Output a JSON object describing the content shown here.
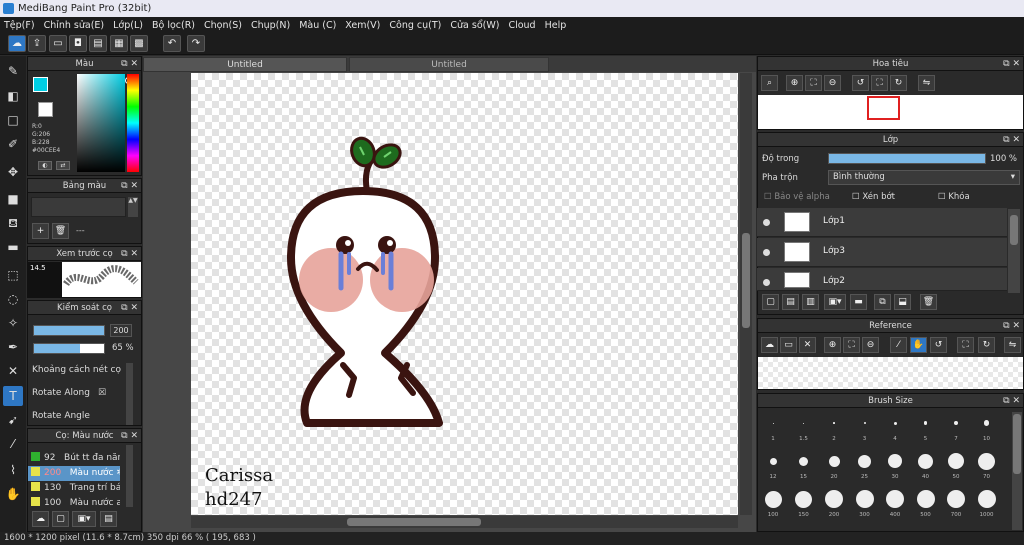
{
  "window": {
    "title": "MediBang Paint Pro (32bit)"
  },
  "menu": [
    "Tệp(F)",
    "Chỉnh sửa(E)",
    "Lớp(L)",
    "Bộ lọc(R)",
    "Chọn(S)",
    "Chụp(N)",
    "Màu (C)",
    "Xem(V)",
    "Công cụ(T)",
    "Cửa sổ(W)",
    "Cloud",
    "Help"
  ],
  "tabs": [
    "Untitled",
    "Untitled"
  ],
  "color": {
    "title": "Màu",
    "r": "R:0",
    "g": "G:206",
    "b": "B:228",
    "hex": "#00CEE4",
    "fg": "#00cee4"
  },
  "palette": {
    "title": "Bảng màu",
    "dash": "---"
  },
  "preview": {
    "title": "Xem trước cọ",
    "size": "14.5"
  },
  "brushctl": {
    "title": "Kiểm soát cọ",
    "size": "200",
    "opacity": "65 %",
    "opts": [
      "Khoảng cách nét cọ",
      "Rotate Along",
      "Rotate Angle"
    ]
  },
  "brushes": {
    "title": "Cọ: Màu nước",
    "items": [
      {
        "size": "92",
        "name": "Bút tt đa năn",
        "color": "#2fb02f"
      },
      {
        "size": "200",
        "name": "Màu nước",
        "color": "#e6e34a",
        "selected": true
      },
      {
        "size": "130",
        "name": "Trang trí bánh",
        "color": "#e6e34a"
      },
      {
        "size": "100",
        "name": "Màu nước arti",
        "color": "#e6e34a"
      }
    ]
  },
  "artwork": {
    "signature1": "Carissa",
    "signature2": "hd247"
  },
  "navigator": {
    "title": "Hoa tiêu"
  },
  "layers": {
    "title": "Lớp",
    "opacity_label": "Độ trong",
    "opacity_value": "100 %",
    "blend_label": "Pha trộn",
    "blend_value": "Bình thường",
    "protect_alpha": "Bảo vệ alpha",
    "clip": "Xén bớt",
    "lock": "Khóa",
    "items": [
      "Lớp1",
      "Lớp3",
      "Lớp2"
    ]
  },
  "reference": {
    "title": "Reference"
  },
  "brushsize": {
    "title": "Brush Size",
    "labels": [
      "1",
      "1.5",
      "2",
      "3",
      "4",
      "5",
      "7",
      "10",
      "12",
      "15",
      "20",
      "25",
      "30",
      "40",
      "50",
      "70",
      "100",
      "150",
      "200",
      "300",
      "400",
      "500",
      "700",
      "1000"
    ]
  },
  "status": {
    "text": "1600 * 1200 pixel   (11.6 * 8.7cm)   350 dpi   66 %   ( 195, 683 )"
  }
}
